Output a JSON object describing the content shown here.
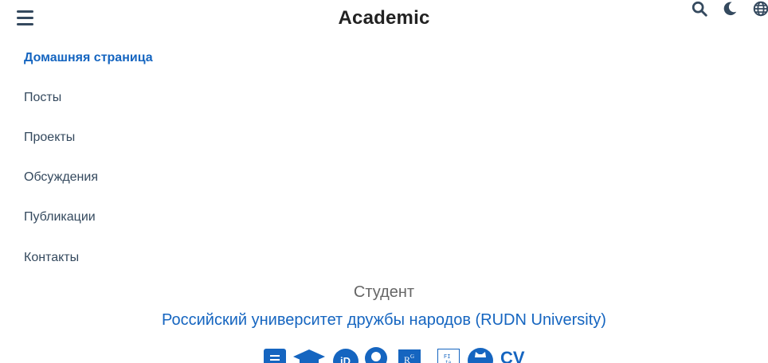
{
  "header": {
    "brand": "Academic",
    "icons": [
      "menu-icon",
      "search-icon",
      "moon-icon",
      "globe-icon"
    ]
  },
  "menu": {
    "items": [
      {
        "label": "Домашняя страница",
        "active": true
      },
      {
        "label": "Посты",
        "active": false
      },
      {
        "label": "Проекты",
        "active": false
      },
      {
        "label": "Обсуждения",
        "active": false
      },
      {
        "label": "Публикации",
        "active": false
      },
      {
        "label": "Контакты",
        "active": false
      }
    ]
  },
  "profile": {
    "role": "Студент",
    "organization": "Российский университет дружбы народов (RUDN University)"
  },
  "social": {
    "icons": [
      "document-icon",
      "graduation-cap-icon",
      "orcid-icon",
      "researchgate-like-icon",
      "researchgate-icon",
      "hal-icon",
      "github-icon"
    ],
    "cv_label": "CV"
  },
  "colors": {
    "accent": "#1565c0",
    "text": "#34495e",
    "muted": "#666666"
  }
}
